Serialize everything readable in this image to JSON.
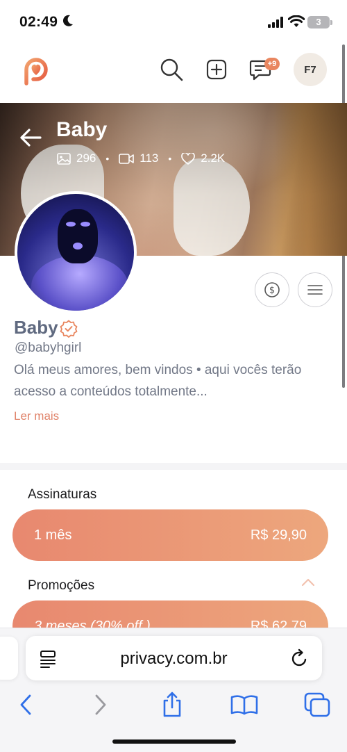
{
  "status_bar": {
    "time": "02:49",
    "battery": "3"
  },
  "header": {
    "chat_badge": "+9",
    "avatar_initials": "F7"
  },
  "cover": {
    "name": "Baby",
    "stats": {
      "photos": "296",
      "videos": "113",
      "likes": "2.2K"
    }
  },
  "profile": {
    "name": "Baby",
    "handle": "@babyhgirl",
    "bio": "Olá meus amores, bem vindos • aqui vocês terão acesso a conteúdos totalmente...",
    "read_more": "Ler mais"
  },
  "subscriptions": {
    "title": "Assinaturas",
    "plans": [
      {
        "period": "1 mês",
        "price": "R$ 29,90"
      }
    ]
  },
  "promotions": {
    "title": "Promoções",
    "plans": [
      {
        "period": "3 meses (30% off )",
        "price": "R$ 62,79"
      }
    ]
  },
  "browser": {
    "url": "privacy.com.br"
  },
  "colors": {
    "accent": "#e9865f",
    "ios_blue": "#2f6fe8"
  }
}
